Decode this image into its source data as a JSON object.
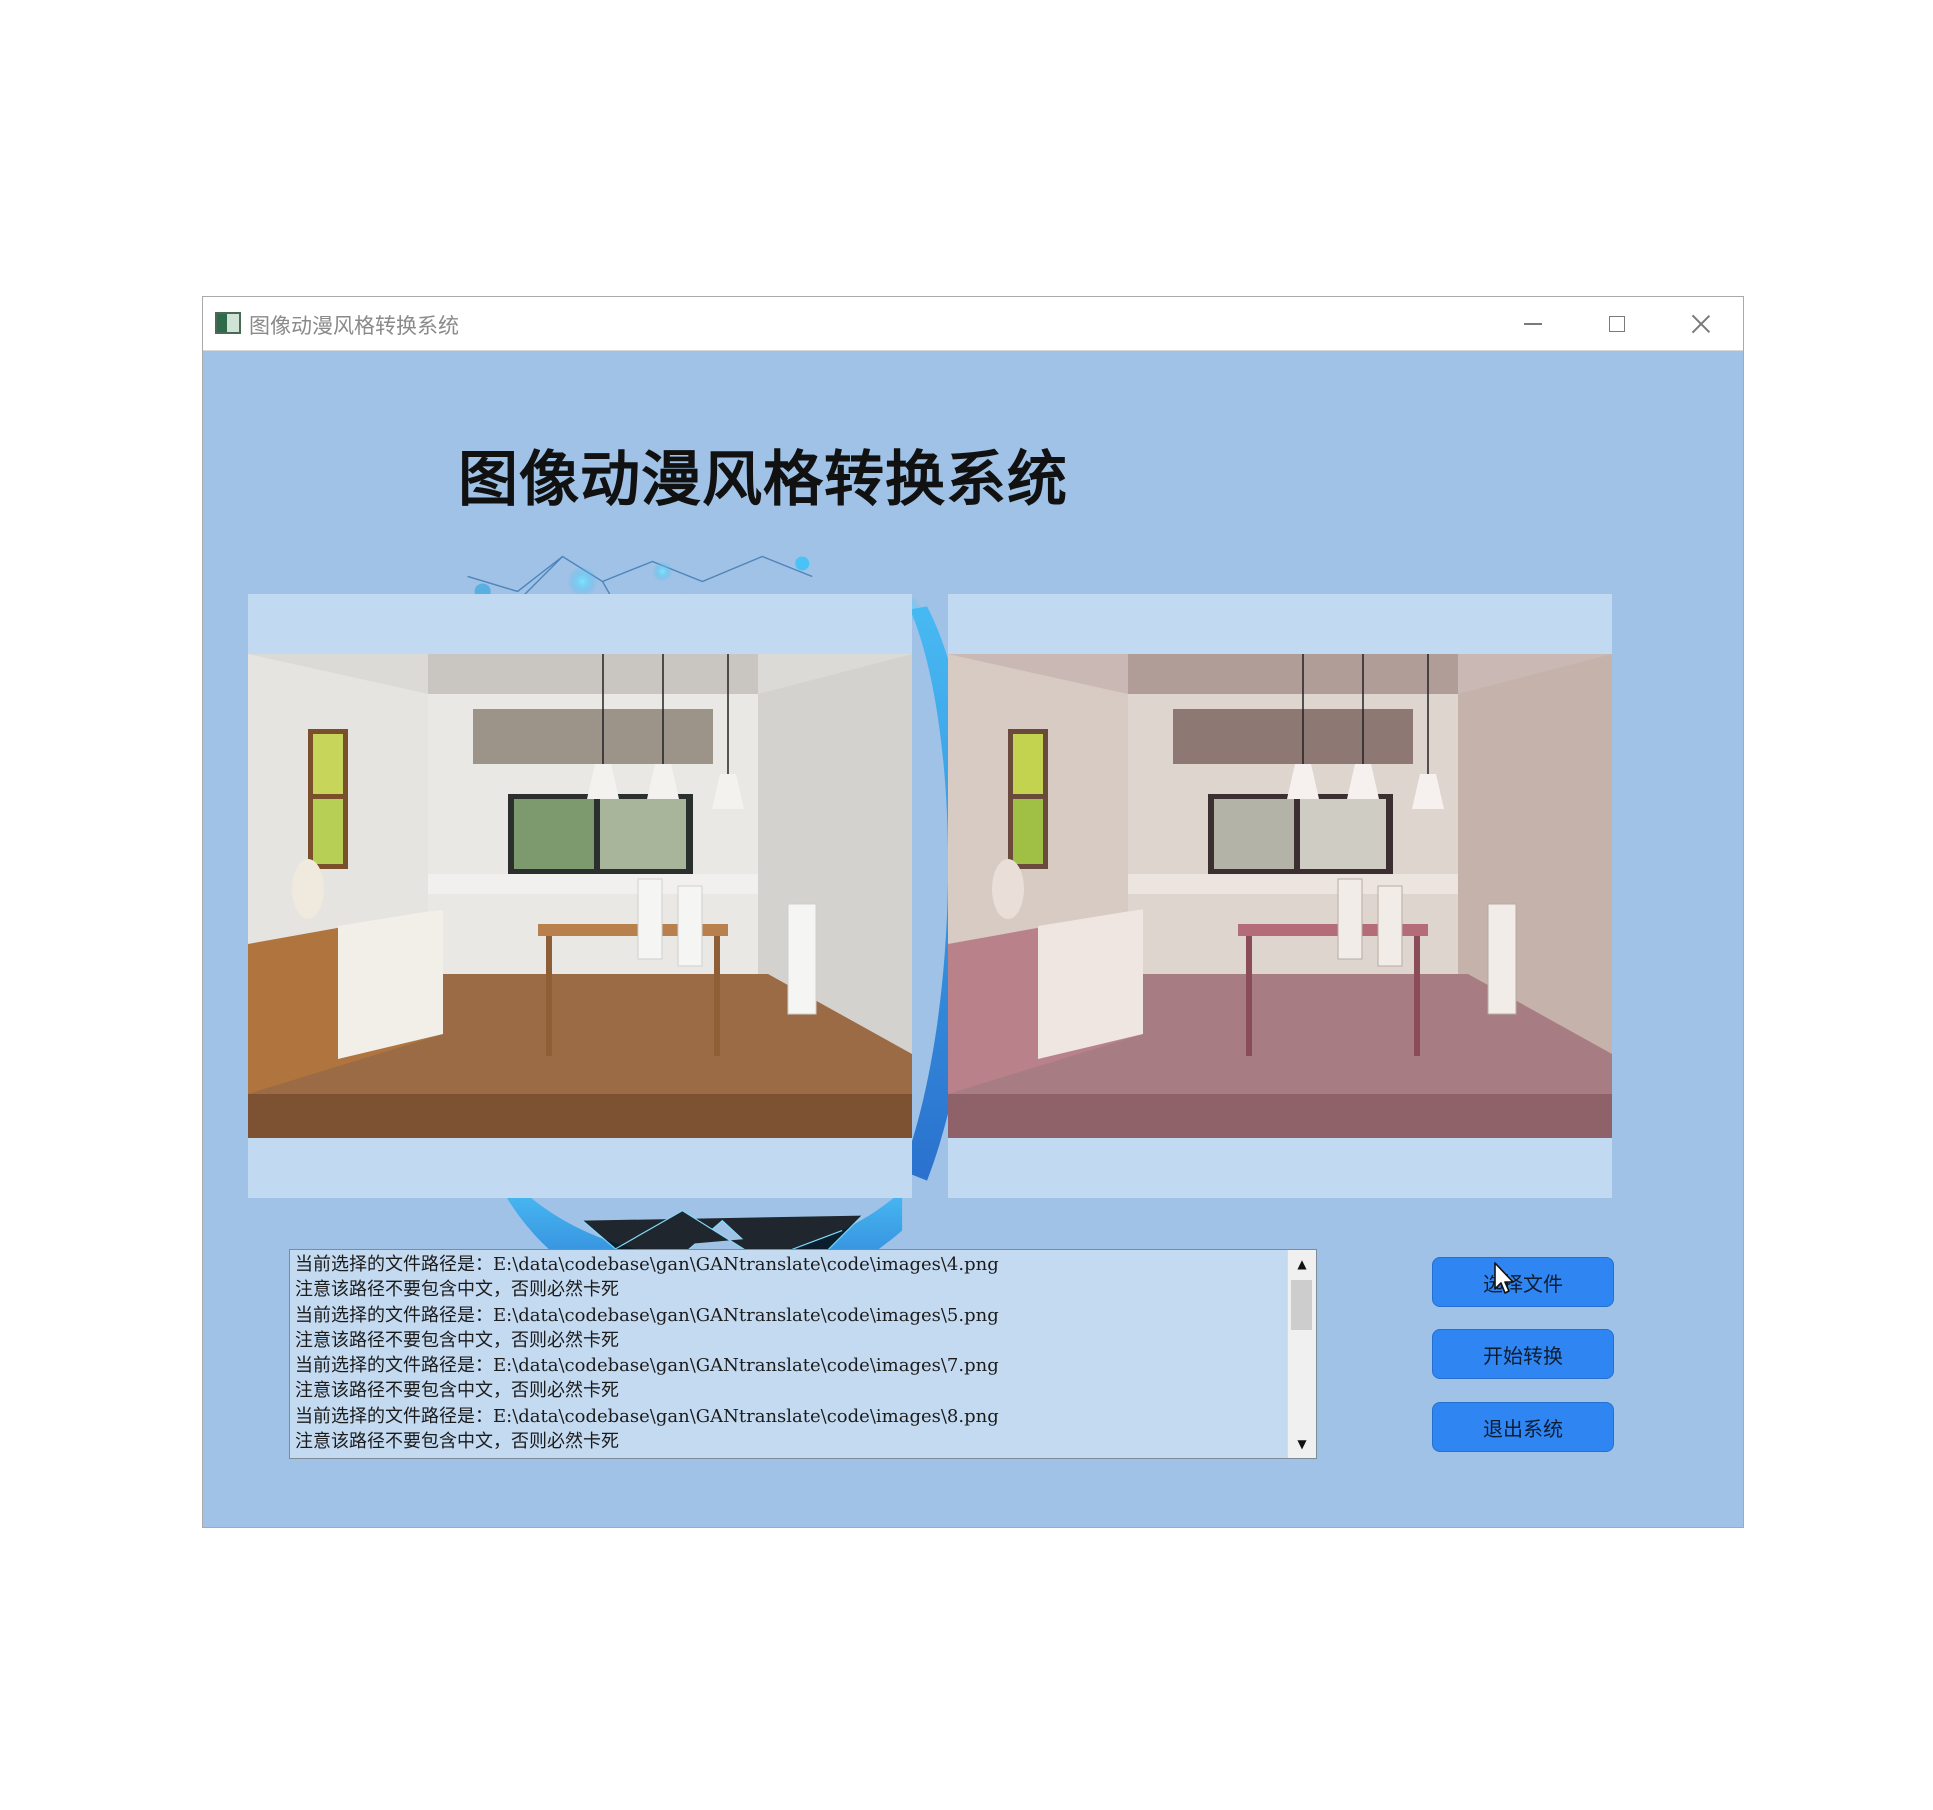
{
  "window": {
    "title": "图像动漫风格转换系统",
    "icons": {
      "app": "app-window-icon",
      "minimize": "minimize-icon",
      "maximize": "maximize-icon",
      "close": "close-icon"
    }
  },
  "main": {
    "heading": "图像动漫风格转换系统",
    "left_image": "original dining room photo",
    "right_image": "anime-style converted dining room photo"
  },
  "log": {
    "lines": [
      "当前选择的文件路径是：E:\\data\\codebase\\gan\\GANtranslate\\code\\images\\4.png",
      "注意该路径不要包含中文，否则必然卡死",
      "当前选择的文件路径是：E:\\data\\codebase\\gan\\GANtranslate\\code\\images\\5.png",
      "注意该路径不要包含中文，否则必然卡死",
      "当前选择的文件路径是：E:\\data\\codebase\\gan\\GANtranslate\\code\\images\\7.png",
      "注意该路径不要包含中文，否则必然卡死",
      "当前选择的文件路径是：E:\\data\\codebase\\gan\\GANtranslate\\code\\images\\8.png",
      "注意该路径不要包含中文，否则必然卡死"
    ]
  },
  "buttons": {
    "select_file": "选择文件",
    "start_convert": "开始转换",
    "exit_system": "退出系统"
  },
  "colors": {
    "background": "#9fc2e6",
    "panel": "#c2daf1",
    "button": "#2f86f2"
  }
}
